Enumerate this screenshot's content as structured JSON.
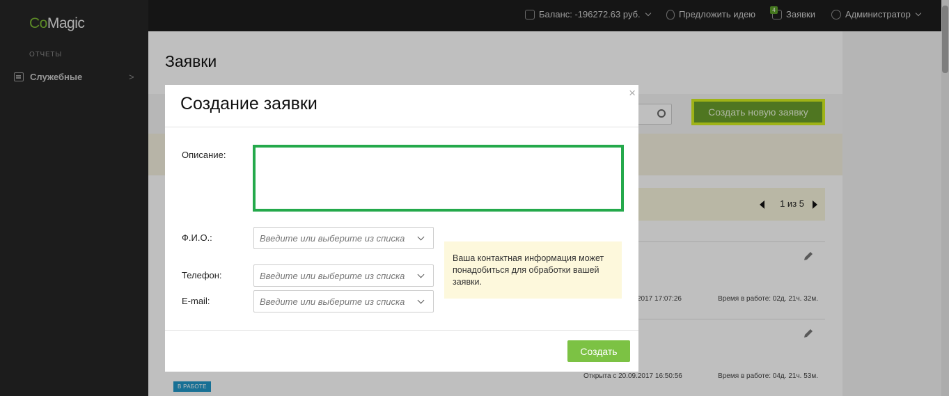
{
  "sidebar": {
    "logo_co": "Co",
    "logo_rest": "Magic",
    "section": "ОТЧЕТЫ",
    "items": [
      {
        "label": "Служебные",
        "arrow": ">"
      }
    ]
  },
  "topbar": {
    "balance": "Баланс: -196272.63 руб.",
    "suggest": "Предложить идею",
    "requests": "Заявки",
    "requests_badge": "4",
    "user": "Администратор"
  },
  "main": {
    "title": "Заявки",
    "create_button": "Создать новую заявку",
    "pager": "1 из 5",
    "rows": [
      {
        "opened": "2017 17:07:26",
        "work_time": "Время в работе: 02д. 21ч. 32м."
      },
      {
        "opened": "Открыта с 20.09.2017 16:50:56",
        "work_time": "Время в работе: 04д. 21ч. 53м.",
        "status": "В РАБОТЕ"
      }
    ]
  },
  "modal": {
    "title": "Создание заявки",
    "close": "×",
    "description_label": "Описание:",
    "description_value": "",
    "name_label": "Ф.И.О.:",
    "phone_label": "Телефон:",
    "email_label": "E-mail:",
    "combo_placeholder": "Введите или выберите из списка",
    "hint": "Ваша контактная информация может понадобиться для обработки вашей заявки.",
    "submit": "Создать"
  }
}
